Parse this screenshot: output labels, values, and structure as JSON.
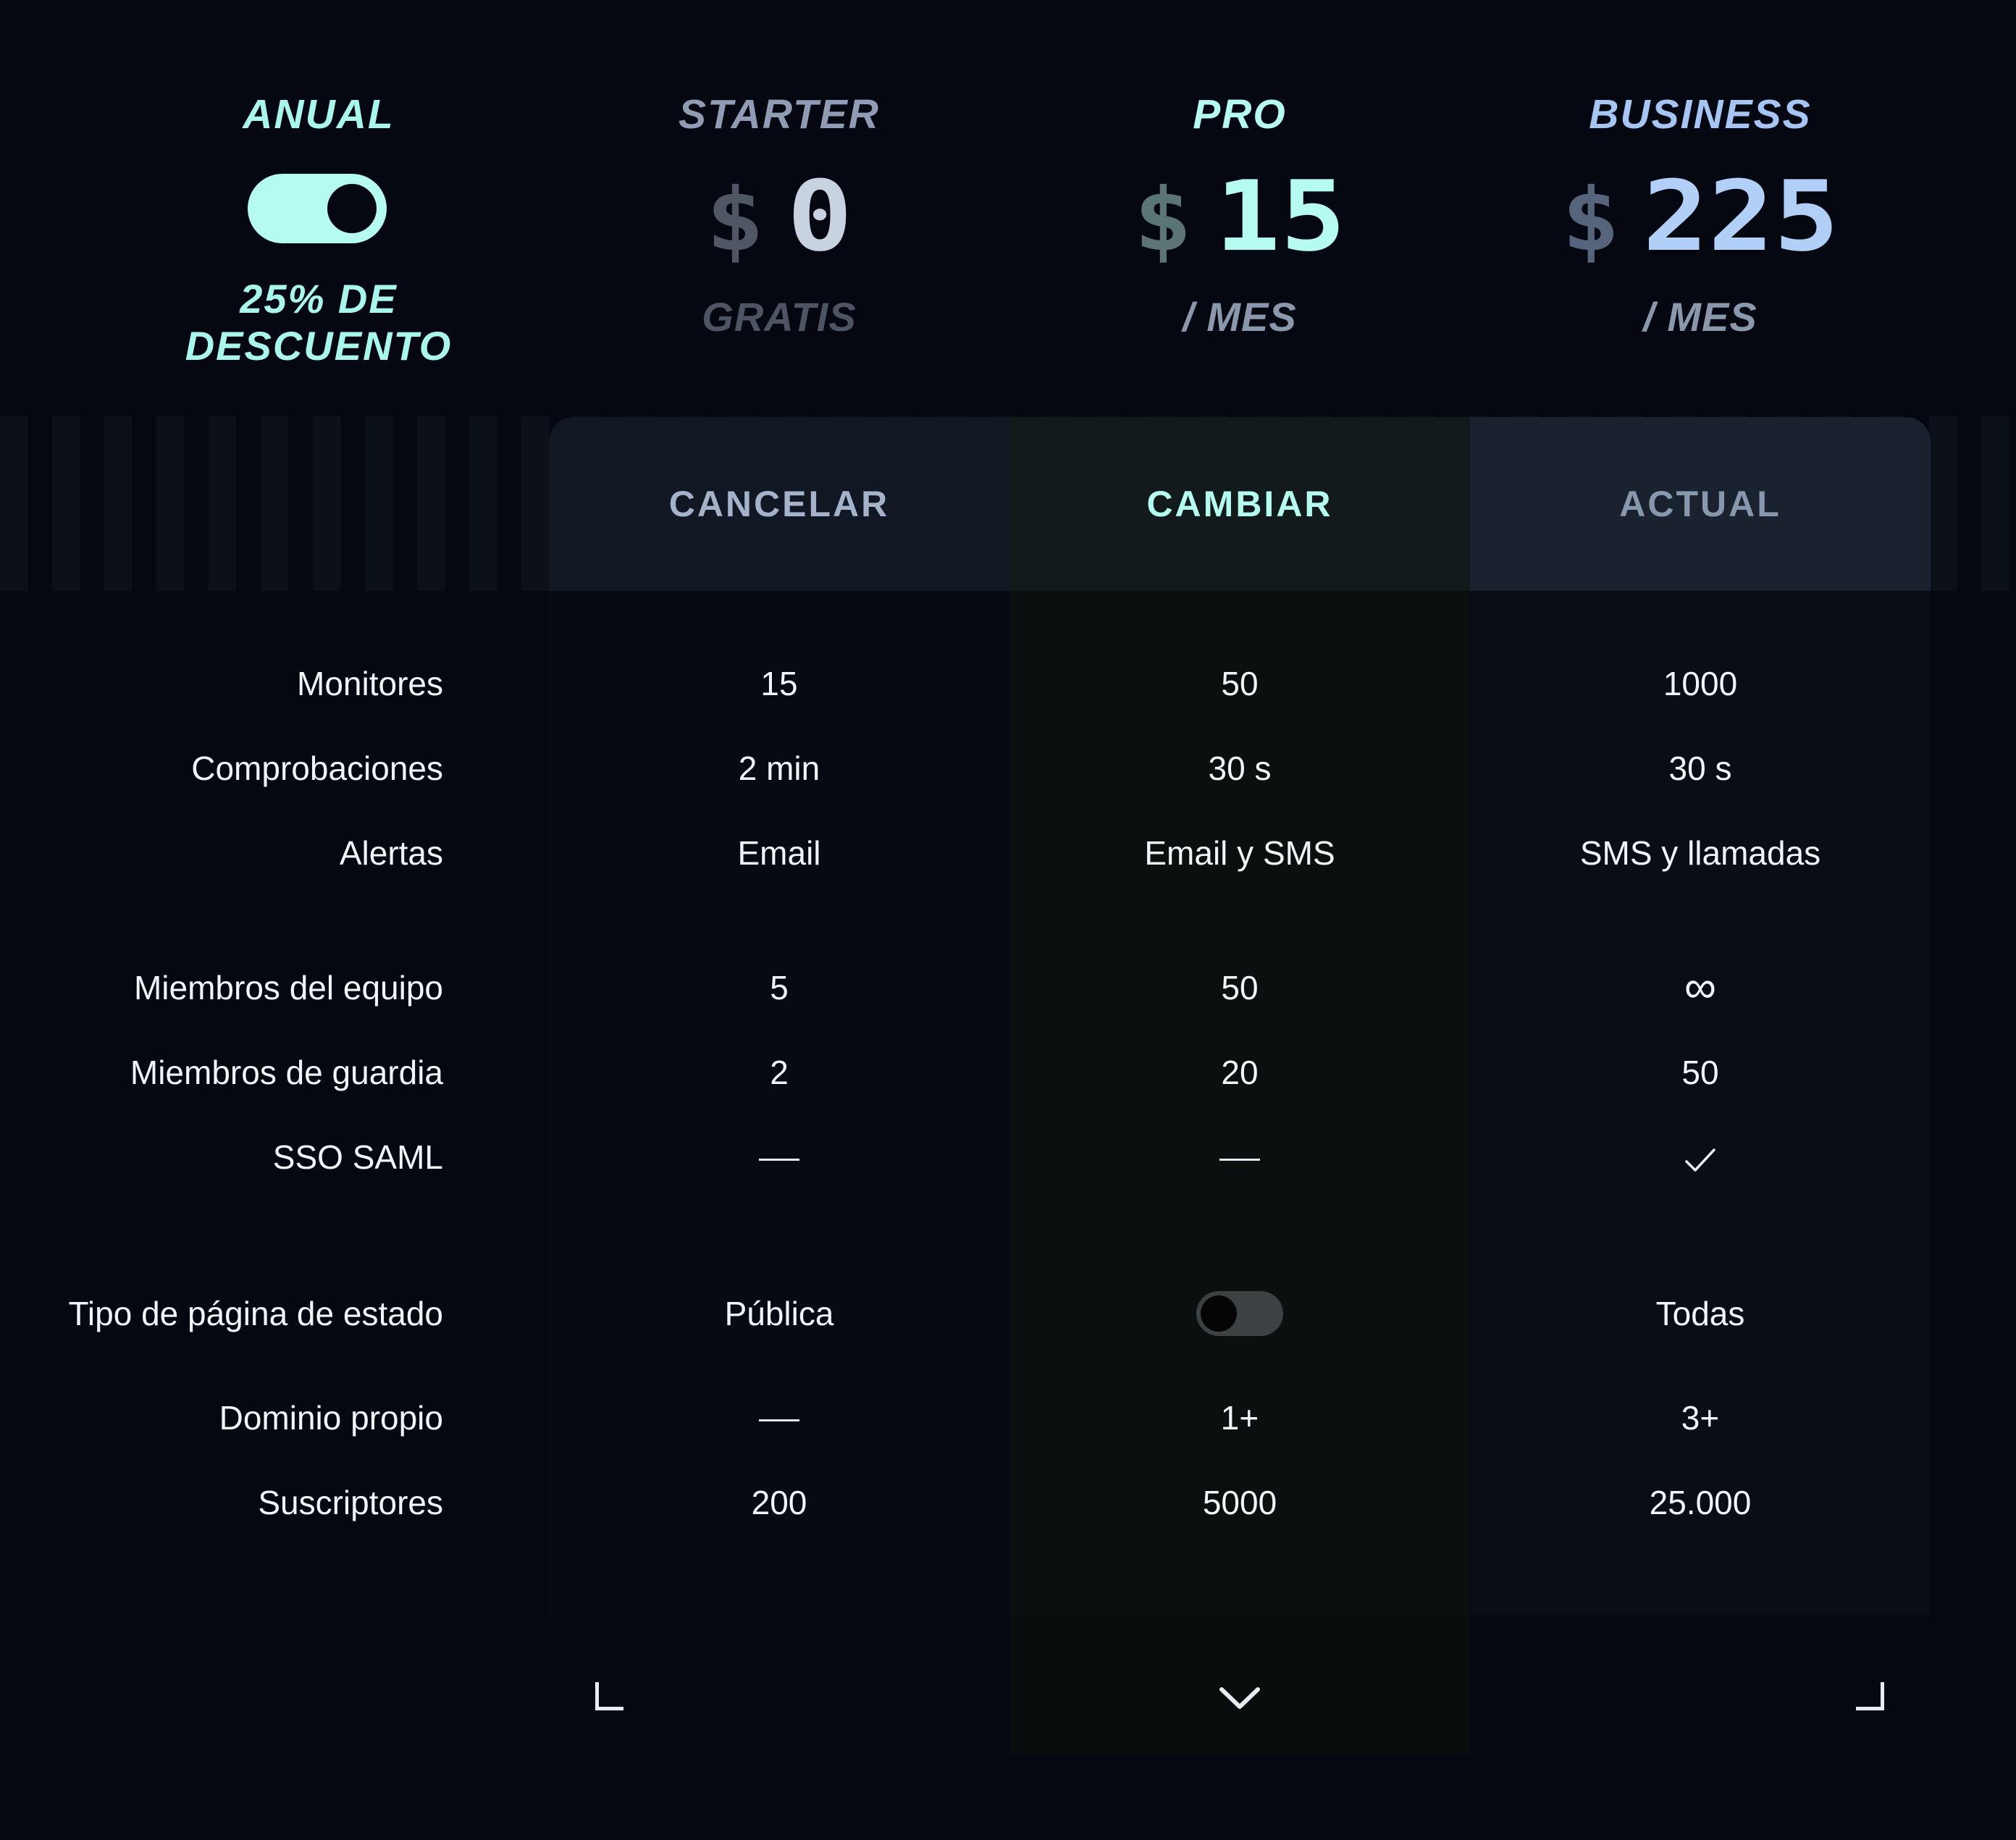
{
  "billing": {
    "toggle_label": "ANUAL",
    "toggle_on": true,
    "discount_label": "25% DE DESCUENTO"
  },
  "plans": [
    {
      "name": "STARTER",
      "currency": "$",
      "price": "0",
      "period": "GRATIS",
      "action": "CANCELAR",
      "name_color": "#8f9cb3",
      "price_color": "#c9d2e0",
      "cur_color": "#4f5664",
      "period_color": "#4d5565",
      "action_color": "#a4b3c9"
    },
    {
      "name": "PRO",
      "currency": "$",
      "price": "15",
      "period": "/ MES",
      "action": "CAMBIAR",
      "name_color": "#b6fbf0",
      "price_color": "#b6fbf0",
      "cur_color": "#5b7574",
      "period_color": "#8b97aa",
      "action_color": "#b6fbf0"
    },
    {
      "name": "BUSINESS",
      "currency": "$",
      "price": "225",
      "period": "/ MES",
      "action": "ACTUAL",
      "name_color": "#a6c5f2",
      "price_color": "#b2cff8",
      "cur_color": "#56657c",
      "period_color": "#8b97aa",
      "action_color": "#8797ad"
    }
  ],
  "features": [
    {
      "label": "Monitores",
      "values": [
        "15",
        "50",
        "1000"
      ]
    },
    {
      "label": "Comprobaciones",
      "values": [
        "2 min",
        "30 s",
        "30 s"
      ]
    },
    {
      "label": "Alertas",
      "values": [
        "Email",
        "Email y SMS",
        "SMS y llamadas"
      ]
    },
    {
      "label": "Miembros del equipo",
      "values": [
        "5",
        "50",
        "∞"
      ]
    },
    {
      "label": "Miembros de guardia",
      "values": [
        "2",
        "20",
        "50"
      ]
    },
    {
      "label": "SSO SAML",
      "values": [
        "—",
        "—",
        "✓"
      ]
    },
    {
      "label": "Tipo de página de estado",
      "values": [
        "Pública",
        "toggle-off",
        "Todas"
      ]
    },
    {
      "label": "Dominio propio",
      "values": [
        "—",
        "1+",
        "3+"
      ]
    },
    {
      "label": "Suscriptores",
      "values": [
        "200",
        "5000",
        "25.000"
      ]
    }
  ],
  "icons": {
    "footer_left": "corner-bracket-left-icon",
    "footer_center": "chevron-down-icon",
    "footer_right": "corner-bracket-right-icon"
  }
}
